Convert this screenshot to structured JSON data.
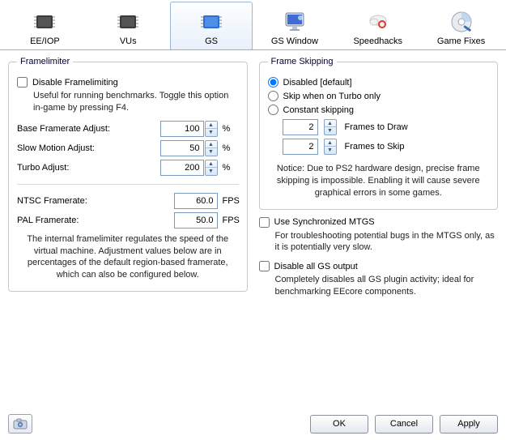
{
  "tabs": {
    "eeiop": "EE/IOP",
    "vus": "VUs",
    "gs": "GS",
    "gswindow": "GS Window",
    "speedhacks": "Speedhacks",
    "gamefixes": "Game Fixes"
  },
  "framelimiter": {
    "legend": "Framelimiter",
    "disable_label": "Disable Framelimiting",
    "disable_checked": false,
    "disable_desc": "Useful for running benchmarks. Toggle this option in-game by pressing F4.",
    "base_label": "Base Framerate Adjust:",
    "base_value": "100",
    "slow_label": "Slow Motion Adjust:",
    "slow_value": "50",
    "turbo_label": "Turbo Adjust:",
    "turbo_value": "200",
    "pct": "%",
    "ntsc_label": "NTSC Framerate:",
    "ntsc_value": "60.0",
    "pal_label": "PAL Framerate:",
    "pal_value": "50.0",
    "fps": "FPS",
    "blurb": "The internal framelimiter regulates the speed of the virtual machine. Adjustment values below are in percentages of the default region-based framerate, which can also be configured below."
  },
  "frameskip": {
    "legend": "Frame Skipping",
    "opt_disabled": "Disabled [default]",
    "opt_turbo": "Skip when on Turbo only",
    "opt_constant": "Constant skipping",
    "selected": "disabled",
    "draw_value": "2",
    "draw_label": "Frames to Draw",
    "skip_value": "2",
    "skip_label": "Frames to Skip",
    "notice": "Notice: Due to PS2 hardware design, precise frame skipping is impossible. Enabling it will cause severe graphical errors in some games."
  },
  "mtgs": {
    "label": "Use Synchronized MTGS",
    "checked": false,
    "desc": "For troubleshooting potential bugs in the MTGS only, as it is potentially very slow."
  },
  "disableGS": {
    "label": "Disable all GS output",
    "checked": false,
    "desc": "Completely disables all GS plugin activity; ideal for benchmarking EEcore components."
  },
  "buttons": {
    "ok": "OK",
    "cancel": "Cancel",
    "apply": "Apply"
  }
}
